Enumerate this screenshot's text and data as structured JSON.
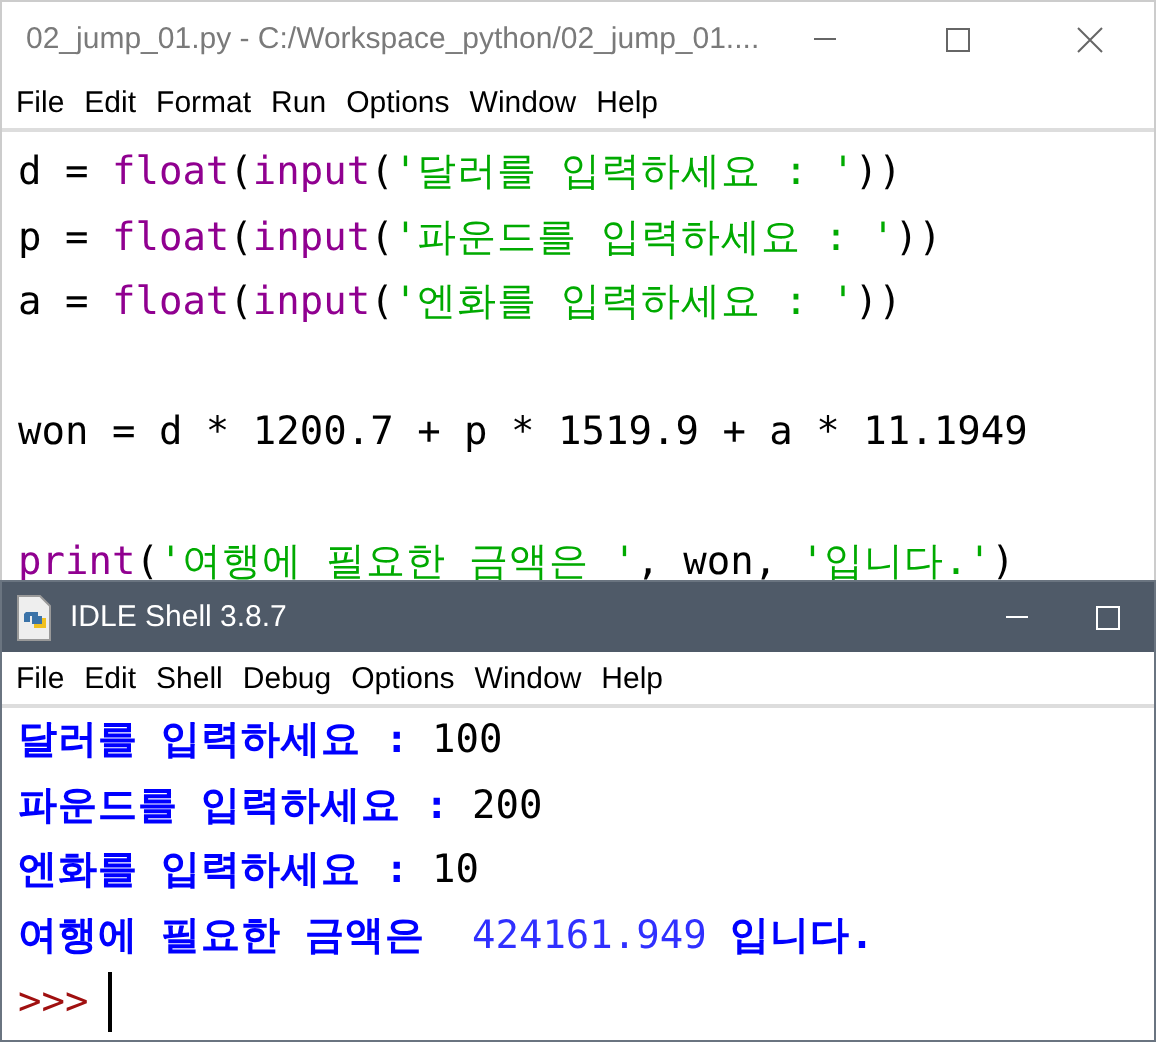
{
  "editor": {
    "title": "02_jump_01.py - C:/Workspace_python/02_jump_01....",
    "active": false,
    "menu": [
      "File",
      "Edit",
      "Format",
      "Run",
      "Options",
      "Window",
      "Help"
    ],
    "lines": [
      {
        "kind": "code",
        "tokens": [
          {
            "kind": "plain",
            "text": "d = "
          },
          {
            "kind": "builtin",
            "text": "float"
          },
          {
            "kind": "plain",
            "text": "("
          },
          {
            "kind": "builtin",
            "text": "input"
          },
          {
            "kind": "plain",
            "text": "("
          },
          {
            "kind": "string",
            "text": "'달러를 입력하세요 : '"
          },
          {
            "kind": "plain",
            "text": "))"
          }
        ]
      },
      {
        "kind": "code",
        "tokens": [
          {
            "kind": "plain",
            "text": "p = "
          },
          {
            "kind": "builtin",
            "text": "float"
          },
          {
            "kind": "plain",
            "text": "("
          },
          {
            "kind": "builtin",
            "text": "input"
          },
          {
            "kind": "plain",
            "text": "("
          },
          {
            "kind": "string",
            "text": "'파운드를 입력하세요 : '"
          },
          {
            "kind": "plain",
            "text": "))"
          }
        ]
      },
      {
        "kind": "code",
        "tokens": [
          {
            "kind": "plain",
            "text": "a = "
          },
          {
            "kind": "builtin",
            "text": "float"
          },
          {
            "kind": "plain",
            "text": "("
          },
          {
            "kind": "builtin",
            "text": "input"
          },
          {
            "kind": "plain",
            "text": "("
          },
          {
            "kind": "string",
            "text": "'엔화를 입력하세요 : '"
          },
          {
            "kind": "plain",
            "text": "))"
          }
        ]
      },
      {
        "kind": "blank"
      },
      {
        "kind": "code",
        "tokens": [
          {
            "kind": "plain",
            "text": "won = d * 1200.7 + p * 1519.9 + a * 11.1949"
          }
        ]
      },
      {
        "kind": "blank"
      },
      {
        "kind": "code",
        "tokens": [
          {
            "kind": "builtin",
            "text": "print"
          },
          {
            "kind": "plain",
            "text": "("
          },
          {
            "kind": "string",
            "text": "'여행에 필요한 금액은 '"
          },
          {
            "kind": "plain",
            "text": ", won, "
          },
          {
            "kind": "string",
            "text": "'입니다.'"
          },
          {
            "kind": "plain",
            "text": ")"
          }
        ]
      }
    ]
  },
  "shell": {
    "title": "IDLE Shell 3.8.7",
    "active": true,
    "menu": [
      "File",
      "Edit",
      "Shell",
      "Debug",
      "Options",
      "Window",
      "Help"
    ],
    "lines": [
      {
        "tokens": [
          {
            "kind": "stdout",
            "text": "달러를 입력하세요 : "
          },
          {
            "kind": "input",
            "text": "100"
          }
        ]
      },
      {
        "tokens": [
          {
            "kind": "stdout",
            "text": "파운드를 입력하세요 : "
          },
          {
            "kind": "input",
            "text": "200"
          }
        ]
      },
      {
        "tokens": [
          {
            "kind": "stdout",
            "text": "엔화를 입력하세요 : "
          },
          {
            "kind": "input",
            "text": "10"
          }
        ]
      },
      {
        "tokens": [
          {
            "kind": "stdout",
            "text": "여행에 필요한 금액은  "
          },
          {
            "kind": "value",
            "text": "424161.949"
          },
          {
            "kind": "stdout",
            "text": " 입니다."
          }
        ]
      }
    ],
    "prompt": ">>>"
  }
}
